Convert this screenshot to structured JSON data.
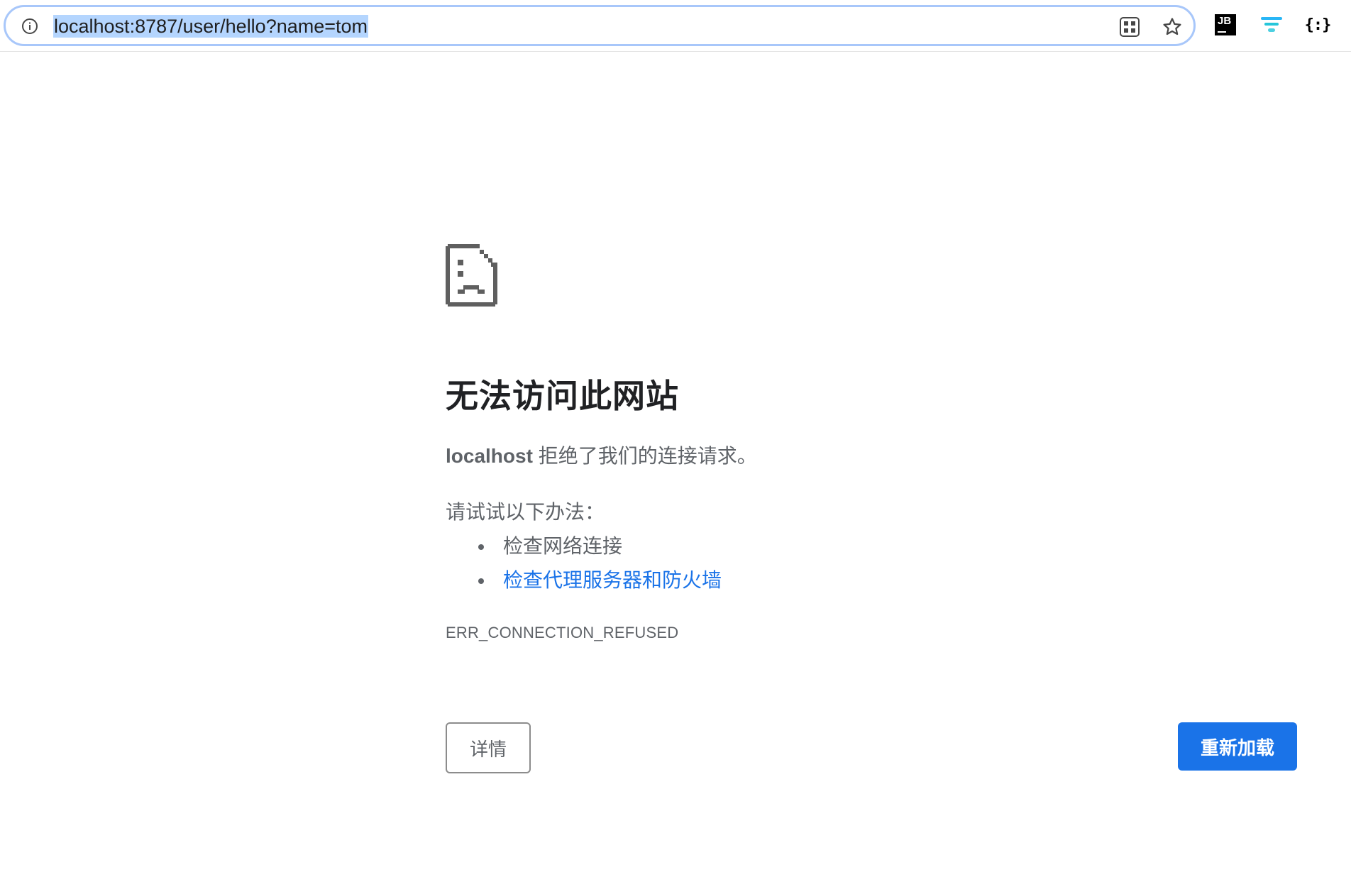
{
  "browser": {
    "url": "localhost:8787/user/hello?name=tom",
    "icons": {
      "site_info": "info-icon",
      "page_actions": "grid-icon",
      "bookmark": "star-icon"
    },
    "extensions": [
      {
        "name": "jetbrains-icon",
        "label": "JB"
      },
      {
        "name": "filter-icon"
      },
      {
        "name": "json-braces-icon",
        "label": "{:}"
      }
    ]
  },
  "error_page": {
    "icon": "sad-page-icon",
    "heading": "无法访问此网站",
    "summary_host": "localhost",
    "summary_text": " 拒绝了我们的连接请求。",
    "try_label": "请试试以下办法：",
    "suggestions": [
      {
        "label": "检查网络连接",
        "is_link": false
      },
      {
        "label": "检查代理服务器和防火墙",
        "is_link": true
      }
    ],
    "error_code": "ERR_CONNECTION_REFUSED",
    "details_label": "详情",
    "reload_label": "重新加载"
  },
  "colors": {
    "accent": "#1a73e8",
    "text_secondary": "#5f6368",
    "url_selection": "#b4d5fe",
    "omnibox_focus": "#a8c7fa"
  }
}
